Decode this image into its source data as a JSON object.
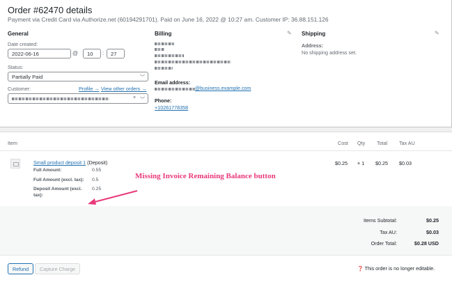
{
  "order": {
    "title": "Order #62470 details",
    "subtitle": "Payment via Credit Card via Authorize.net (60194291701). Paid on June 16, 2022 @ 10:27 am. Customer IP: 36.88.151.126"
  },
  "general": {
    "heading": "General",
    "date_label": "Date created:",
    "date_value": "2022-06-16",
    "at": "@",
    "hour": "10",
    "colon": ":",
    "minute": "27",
    "status_label": "Status:",
    "status_value": "Partially Paid",
    "customer_label": "Customer:",
    "profile_link": "Profile →",
    "view_orders_link": "View other orders →",
    "clear_x": "×"
  },
  "billing": {
    "heading": "Billing",
    "email_label": "Email address:",
    "email_value": "@business.example.com",
    "phone_label": "Phone:",
    "phone_value": "+10261778358"
  },
  "shipping": {
    "heading": "Shipping",
    "address_label": "Address:",
    "address_value": "No shipping address set."
  },
  "items": {
    "headers": {
      "item": "Item",
      "cost": "Cost",
      "qty": "Qty",
      "total": "Total",
      "tax": "Tax AU"
    },
    "row": {
      "name": "Small product deposit 1",
      "suffix": "(Deposit)",
      "cost": "$0.25",
      "qty": "× 1",
      "total": "$0.25",
      "tax": "$0.03",
      "meta": [
        {
          "key": "Full Amount:",
          "value": "0.55"
        },
        {
          "key": "Full Amount (excl. tax):",
          "value": "0.5"
        },
        {
          "key": "Deposit Amount (excl.",
          "key2": "tax):",
          "value": "0.25"
        }
      ]
    }
  },
  "annotation": {
    "text": "Missing Invoice Remaining Balance button",
    "color": "#e9397a"
  },
  "totals": {
    "subtotal_label": "Items Subtotal:",
    "subtotal_value": "$0.25",
    "tax_label": "Tax AU:",
    "tax_value": "$0.03",
    "order_total_label": "Order Total:",
    "order_total_value": "$0.28 USD"
  },
  "actions": {
    "refund_label": "Refund",
    "capture_label": "Capture Charge",
    "note": "This order is no longer editable."
  },
  "colors": {
    "link": "#2271b1",
    "accent": "#e9397a"
  }
}
